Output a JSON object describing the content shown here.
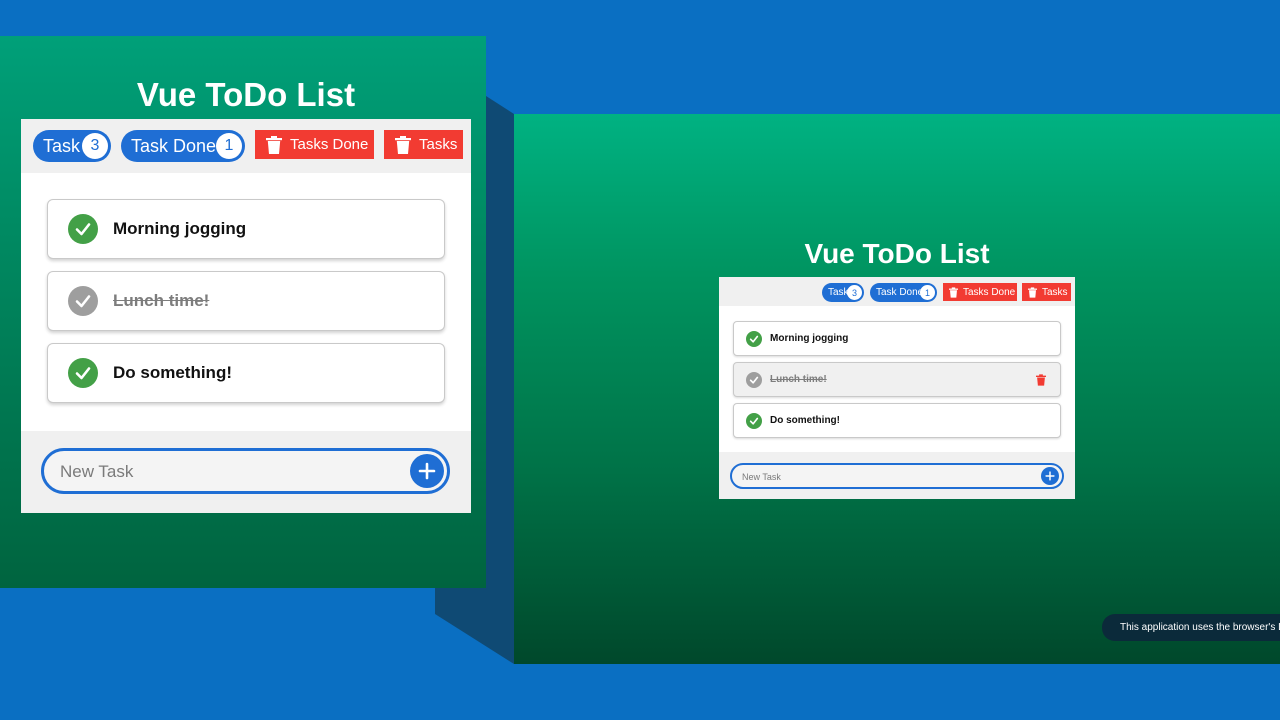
{
  "app": {
    "title": "Vue ToDo List"
  },
  "toolbar": {
    "task_label": "Task",
    "task_count": "3",
    "done_label": "Task Done",
    "done_count": "1",
    "clear_done_label": "Tasks Done",
    "clear_all_label": "Tasks"
  },
  "tasks": [
    {
      "label": "Morning jogging",
      "done": false
    },
    {
      "label": "Lunch time!",
      "done": true
    },
    {
      "label": "Do something!",
      "done": false
    }
  ],
  "new_task": {
    "placeholder": "New Task"
  },
  "storage_notice": "This application uses the browser's Loc",
  "colors": {
    "page_background": "#0a6fc2",
    "primary": "#1f6ed4",
    "danger": "#f23b32",
    "check_active": "#43a047",
    "check_done": "#9e9e9e"
  }
}
